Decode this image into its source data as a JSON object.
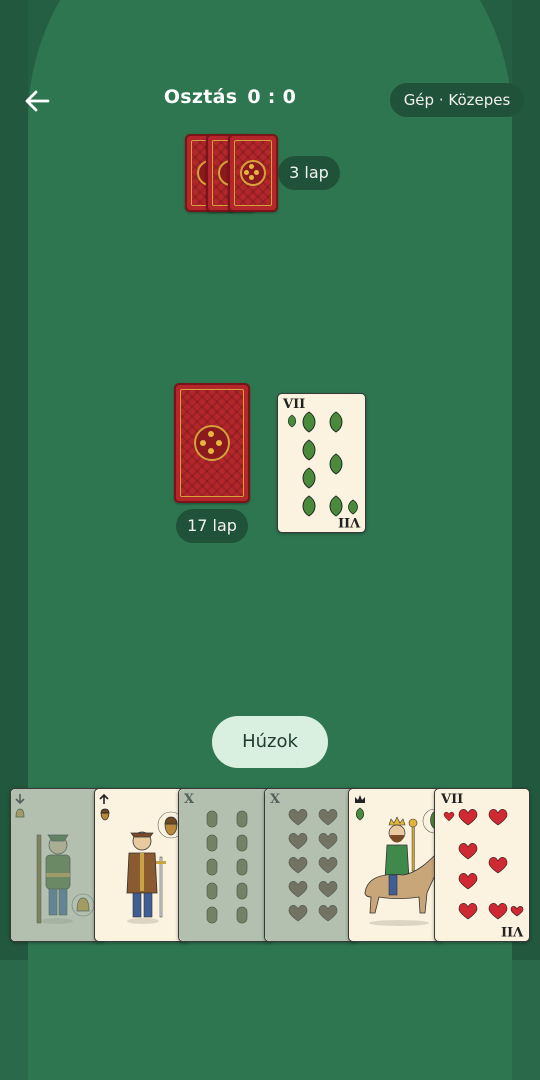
{
  "header": {
    "title": "Osztás",
    "score": "0 : 0",
    "difficulty": "Gép · Közepes"
  },
  "opponent": {
    "card_count_label": "3 lap",
    "cards_in_hand": 3
  },
  "deck": {
    "remaining_label": "17 lap"
  },
  "trump_card": {
    "rank": "VII",
    "suit": "leaves",
    "suit_color": "#4a8a3c"
  },
  "actions": {
    "draw_label": "Húzok"
  },
  "player_hand": [
    {
      "rank": "Alsó",
      "suit": "bells",
      "playable": false
    },
    {
      "rank": "Felső",
      "suit": "acorns",
      "playable": true
    },
    {
      "rank": "X",
      "suit": "acorns",
      "playable": false
    },
    {
      "rank": "X",
      "suit": "hearts",
      "playable": false
    },
    {
      "rank": "Király",
      "suit": "leaves",
      "playable": true
    },
    {
      "rank": "VII",
      "suit": "hearts",
      "playable": true
    }
  ],
  "colors": {
    "felt": "#2e7650",
    "card_back": "#b3262a",
    "hearts": "#cf2a33",
    "leaves": "#4a8a3c",
    "acorns": "#6b6b3a"
  }
}
